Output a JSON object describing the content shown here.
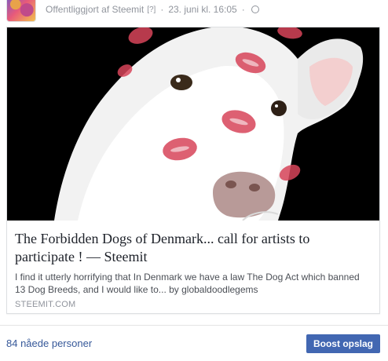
{
  "post": {
    "published_by": "Offentliggjort af Steemit",
    "help_marker": "[?]",
    "separator": "·",
    "date": "23. juni kl. 16:05",
    "separator2": "·"
  },
  "link_preview": {
    "title": "The Forbidden Dogs of Denmark... call for artists to participate ! — Steemit",
    "description": "I find it utterly horrifying that In Denmark we have a law The Dog Act which banned 13 Dog Breeds, and I would like to... by globaldoodlegems",
    "domain": "STEEMIT.COM"
  },
  "footer": {
    "reach": "84 nåede personer",
    "boost_label": "Boost opslag"
  },
  "colors": {
    "link": "#365899",
    "boost_button": "#4267b2",
    "meta_text": "#90949c"
  }
}
